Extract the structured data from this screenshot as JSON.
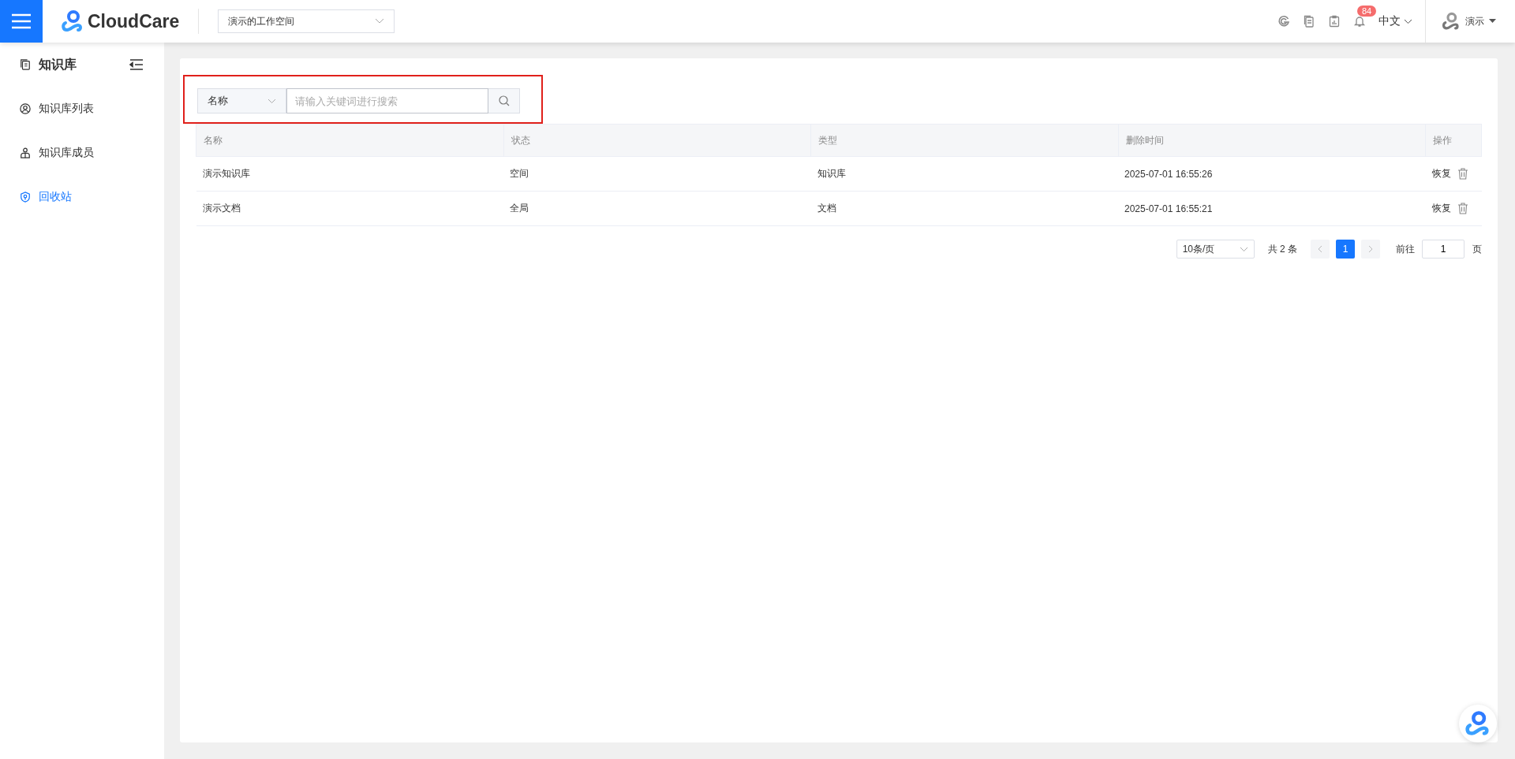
{
  "header": {
    "logo": "CloudCare",
    "workspace": "演示的工作空间",
    "notification_count": "84",
    "language": "中文",
    "user": "演示"
  },
  "sidebar": {
    "title": "知识库",
    "items": [
      {
        "label": "知识库列表",
        "selected": false
      },
      {
        "label": "知识库成员",
        "selected": false
      },
      {
        "label": "回收站",
        "selected": true
      }
    ]
  },
  "search": {
    "highlighted": true,
    "field": "名称",
    "placeholder": "请输入关键词进行搜索"
  },
  "table": {
    "columns": [
      "名称",
      "状态",
      "类型",
      "删除时间",
      "操作"
    ],
    "rows": [
      {
        "name": "演示知识库",
        "status": "空间",
        "type": "知识库",
        "deleted_at": "2025-07-01 16:55:26",
        "action": "恢复"
      },
      {
        "name": "演示文档",
        "status": "全局",
        "type": "文档",
        "deleted_at": "2025-07-01 16:55:21",
        "action": "恢复"
      }
    ]
  },
  "pagination": {
    "page_size": "10条/页",
    "total": "共 2 条",
    "pages": [
      {
        "label": "1",
        "selected": true
      }
    ],
    "goto_label": "前往",
    "goto_value": "1",
    "page_suffix": "页"
  }
}
